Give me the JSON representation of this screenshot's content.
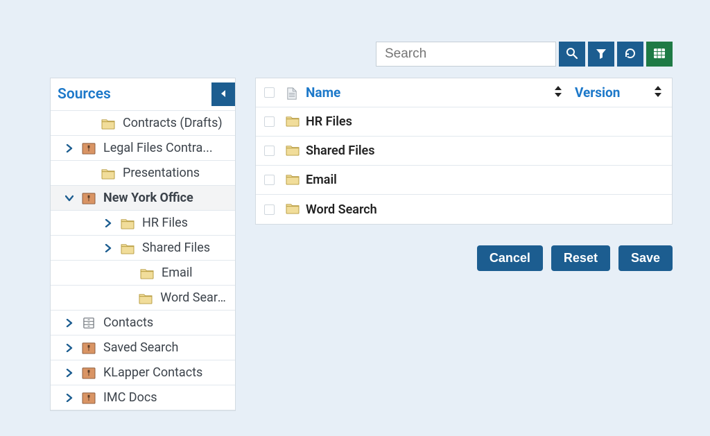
{
  "search": {
    "placeholder": "Search"
  },
  "sidebar": {
    "title": "Sources",
    "nodes": [
      {
        "label": "Contracts (Drafts)",
        "icon": "folder",
        "indent": 1,
        "expand": "none",
        "selected": false
      },
      {
        "label": "Legal Files Contra...",
        "icon": "locked",
        "indent": 0,
        "expand": "right",
        "selected": false
      },
      {
        "label": "Presentations",
        "icon": "folder",
        "indent": 1,
        "expand": "none",
        "selected": false
      },
      {
        "label": "New York Office",
        "icon": "locked",
        "indent": 0,
        "expand": "down",
        "selected": true
      },
      {
        "label": "HR Files",
        "icon": "folder",
        "indent": 2,
        "expand": "right",
        "selected": false
      },
      {
        "label": "Shared Files",
        "icon": "folder",
        "indent": 2,
        "expand": "right",
        "selected": false
      },
      {
        "label": "Email",
        "icon": "folder",
        "indent": 3,
        "expand": "none",
        "selected": false
      },
      {
        "label": "Word Search",
        "icon": "folder",
        "indent": 3,
        "expand": "none",
        "selected": false
      },
      {
        "label": "Contacts",
        "icon": "cabinet",
        "indent": 0,
        "expand": "right",
        "selected": false
      },
      {
        "label": "Saved Search",
        "icon": "locked",
        "indent": 0,
        "expand": "right",
        "selected": false
      },
      {
        "label": "KLapper Contacts",
        "icon": "locked",
        "indent": 0,
        "expand": "right",
        "selected": false
      },
      {
        "label": "IMC Docs",
        "icon": "locked",
        "indent": 0,
        "expand": "right",
        "selected": false
      }
    ]
  },
  "table": {
    "columns": {
      "name": "Name",
      "version": "Version"
    },
    "rows": [
      {
        "name": "HR Files",
        "icon": "folder"
      },
      {
        "name": "Shared Files",
        "icon": "folder"
      },
      {
        "name": "Email",
        "icon": "folder"
      },
      {
        "name": "Word Search",
        "icon": "folder"
      }
    ]
  },
  "actions": {
    "cancel": "Cancel",
    "reset": "Reset",
    "save": "Save"
  }
}
